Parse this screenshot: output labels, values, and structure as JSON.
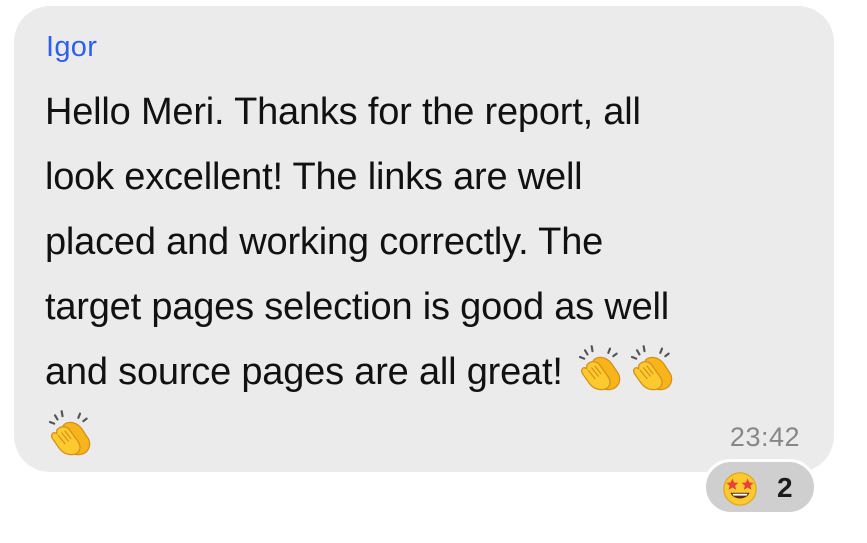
{
  "message": {
    "sender_name": "Igor",
    "sender_color": "#2f5ff0",
    "lines": [
      "Hello Meri. Thanks for the report, all",
      "look excellent! The links are well",
      "placed and working correctly. The",
      "target pages selection is good as well",
      "and source pages are all great!"
    ],
    "trailing_emoji": [
      "clapping-hands-emoji",
      "clapping-hands-emoji",
      "clapping-hands-emoji"
    ],
    "timestamp": "23:42",
    "bubble_color": "#ebebeb"
  },
  "reaction": {
    "emoji": "star-struck-emoji",
    "count": "2"
  }
}
